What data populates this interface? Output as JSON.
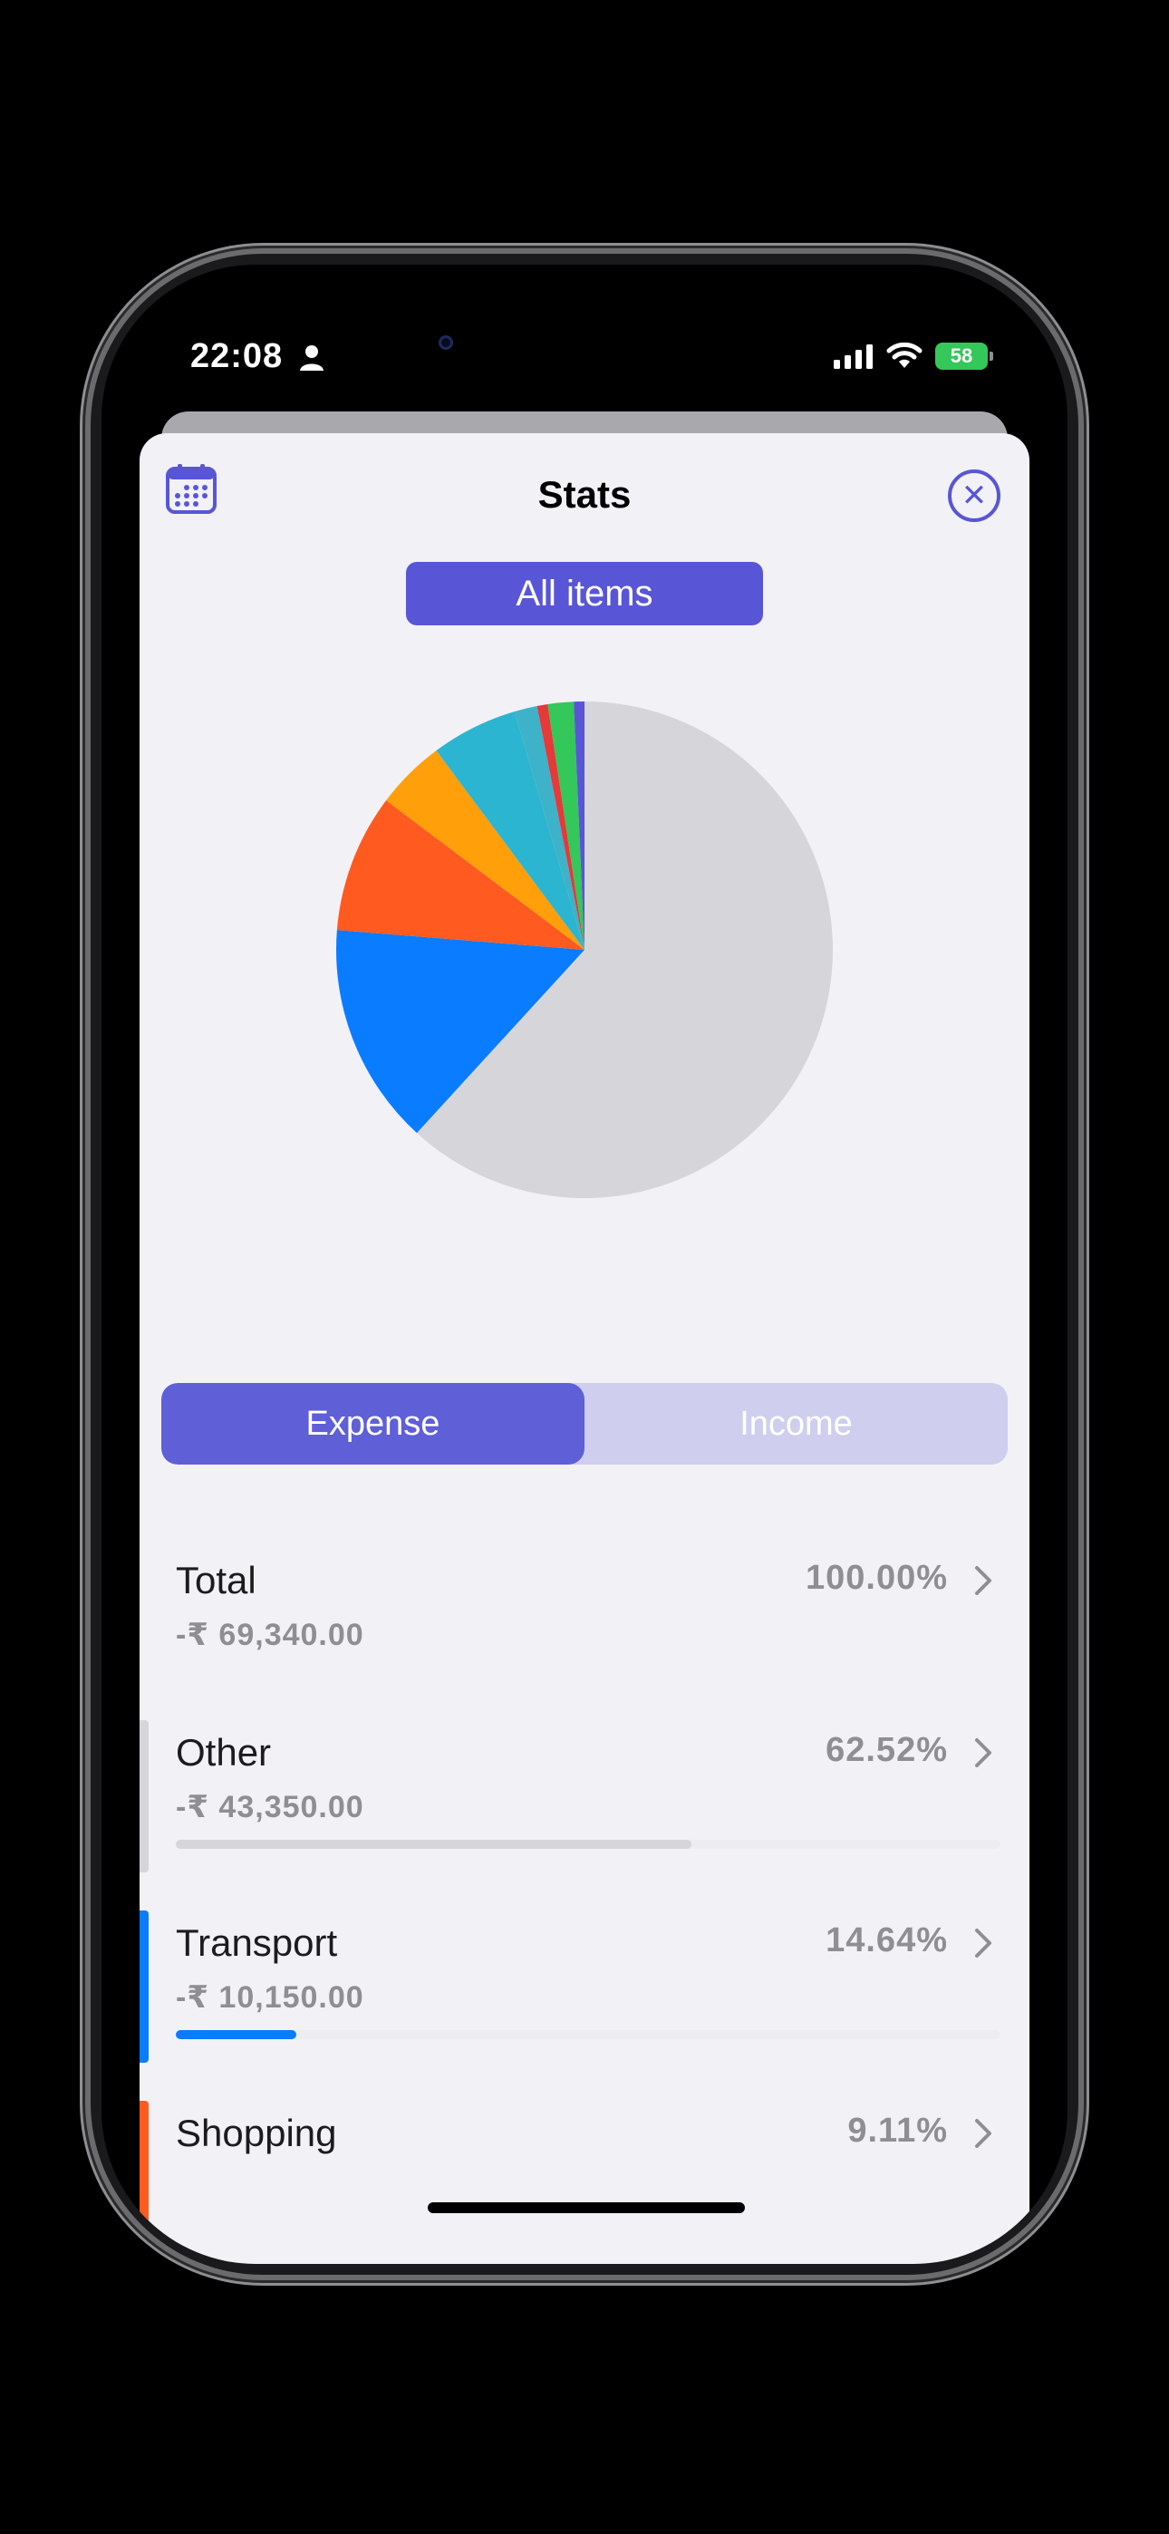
{
  "status": {
    "time": "22:08",
    "battery": "58"
  },
  "header": {
    "title": "Stats",
    "filter_label": "All items"
  },
  "tabs": [
    {
      "label": "Expense",
      "active": true
    },
    {
      "label": "Income",
      "active": false
    }
  ],
  "chart_data": {
    "type": "pie",
    "slices": [
      {
        "label": "Other",
        "percent": 62.52,
        "color": "#d6d6da"
      },
      {
        "label": "Transport",
        "percent": 14.64,
        "color": "#0a7cff"
      },
      {
        "label": "Shopping",
        "percent": 9.11,
        "color": "#ff5a1f"
      },
      {
        "label": "",
        "percent": 4.6,
        "color": "#ff9f0a"
      },
      {
        "label": "",
        "percent": 5.7,
        "color": "#2bb5d1"
      },
      {
        "label": "",
        "percent": 1.5,
        "color": "#3db2c9"
      },
      {
        "label": "",
        "percent": 0.7,
        "color": "#e5393a"
      },
      {
        "label": "",
        "percent": 1.7,
        "color": "#34c759"
      },
      {
        "label": "",
        "percent": 0.7,
        "color": "#5856d6"
      }
    ]
  },
  "rows": [
    {
      "name": "Total",
      "amount": "-₹ 69,340.00",
      "percent": "100.00%",
      "share": null,
      "color": null
    },
    {
      "name": "Other",
      "amount": "-₹ 43,350.00",
      "percent": "62.52%",
      "share": 0.6252,
      "color": "#d6d6da"
    },
    {
      "name": "Transport",
      "amount": "-₹ 10,150.00",
      "percent": "14.64%",
      "share": 0.1464,
      "color": "#0a7cff"
    },
    {
      "name": "Shopping",
      "amount": "",
      "percent": "9.11%",
      "share": 0.0911,
      "color": "#ff5a1f"
    }
  ],
  "colors": {
    "accent": "#5856d6",
    "segment_bg": "#cfceef"
  }
}
